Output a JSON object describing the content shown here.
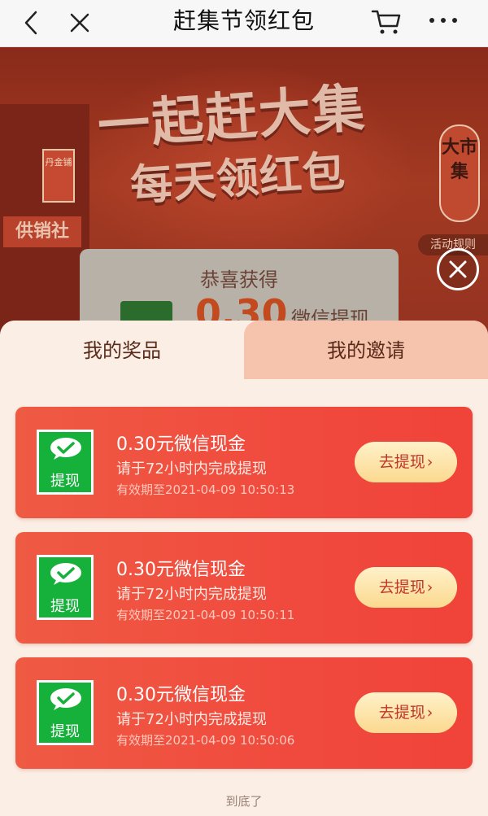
{
  "nav": {
    "title": "赶集节领红包"
  },
  "background": {
    "headline_line1": "一起赶大集",
    "headline_line2": "每天领红包",
    "sign_supply_coop": "供销社",
    "vertical_sign": "丹金铺",
    "right_sign": "大市集",
    "rules_label": "活动规则",
    "panel_congrats": "恭喜获得",
    "panel_amount": "0.30",
    "panel_wx_label": "微信提现"
  },
  "sheet": {
    "tabs": [
      {
        "label": "我的奖品",
        "active": true
      },
      {
        "label": "我的邀请",
        "active": false
      }
    ],
    "prizes": [
      {
        "badge_label": "提现",
        "title": "0.30元微信现金",
        "subtitle": "请于72小时内完成提现",
        "expiry": "有效期至2021-04-09 10:50:13",
        "button_label": "去提现"
      },
      {
        "badge_label": "提现",
        "title": "0.30元微信现金",
        "subtitle": "请于72小时内完成提现",
        "expiry": "有效期至2021-04-09 10:50:11",
        "button_label": "去提现"
      },
      {
        "badge_label": "提现",
        "title": "0.30元微信现金",
        "subtitle": "请于72小时内完成提现",
        "expiry": "有效期至2021-04-09 10:50:06",
        "button_label": "去提现"
      }
    ],
    "end_note": "到底了"
  },
  "colors": {
    "card_red": "#f04a3e",
    "badge_green": "#16b13a",
    "button_gold": "#fbd98f",
    "tab_inactive": "#f6c4ad",
    "sheet_bg": "#fbeee5"
  }
}
